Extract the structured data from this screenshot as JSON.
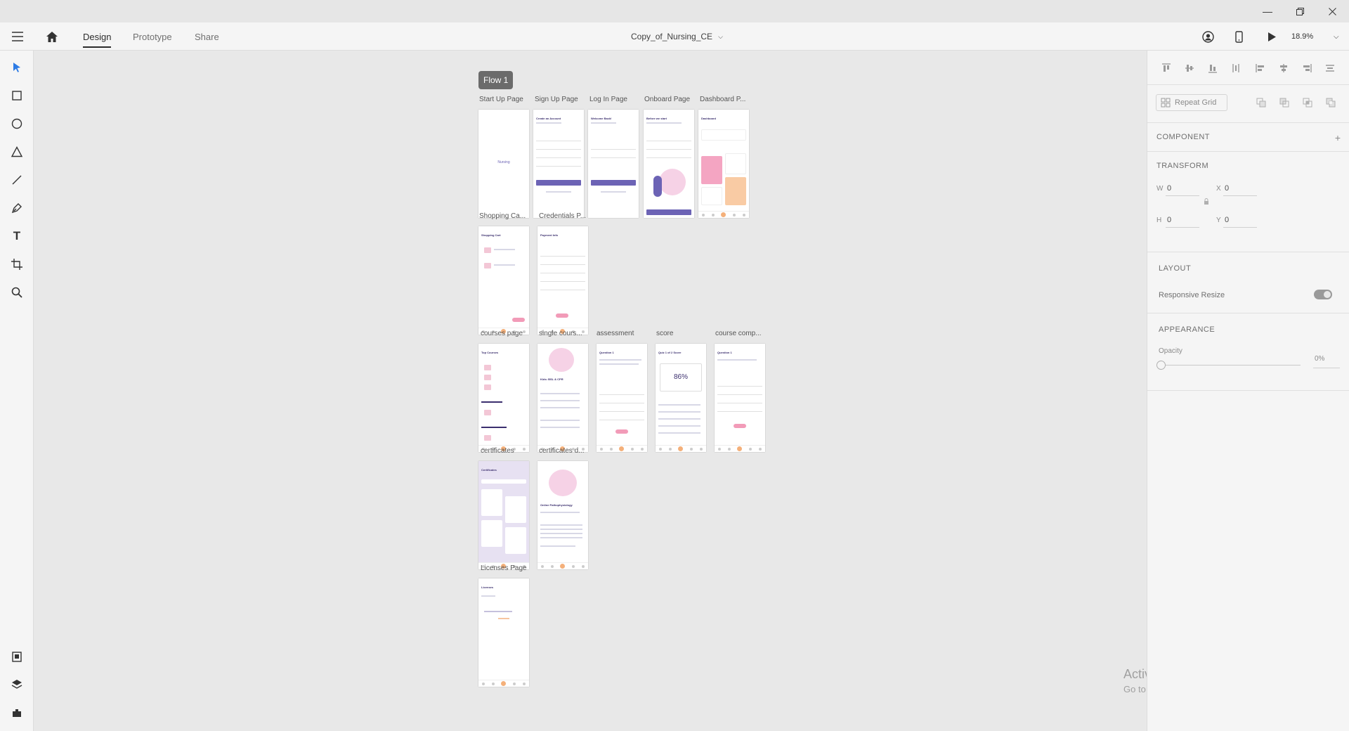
{
  "window": {
    "controls": [
      "minimize",
      "restore",
      "close"
    ]
  },
  "appbar": {
    "tabs": [
      {
        "label": "Design",
        "active": true
      },
      {
        "label": "Prototype",
        "active": false
      },
      {
        "label": "Share",
        "active": false
      }
    ],
    "document_title": "Copy_of_Nursing_CE",
    "zoom": "18.9%"
  },
  "toolbar": {
    "tools": [
      "select-icon",
      "rectangle-icon",
      "ellipse-icon",
      "polygon-icon",
      "line-icon",
      "pen-icon",
      "text-icon",
      "artboard-icon",
      "zoom-icon"
    ],
    "bottom_tools": [
      "document-assets-icon",
      "layers-icon",
      "plugins-icon"
    ]
  },
  "canvas": {
    "flow_label": "Flow 1",
    "artboards": [
      {
        "label": "Start Up Page",
        "title": "Nursing"
      },
      {
        "label": "Sign Up Page",
        "title": "Create an Account"
      },
      {
        "label": "Log In Page",
        "title": "Welcome Back!"
      },
      {
        "label": "Onboard Page",
        "title": "Before we start"
      },
      {
        "label": "Dashboard P...",
        "title": "Dashboard"
      },
      {
        "label": "Shopping Ca...",
        "title": "Shopping Cart"
      },
      {
        "label": "Credentials P...",
        "title": "Payment Info"
      },
      {
        "label": "courses page",
        "title": "Top Courses"
      },
      {
        "label": "single cours...",
        "title": "Kids: BSL & CPR"
      },
      {
        "label": "assessment",
        "title": "Question 1"
      },
      {
        "label": "score",
        "title": "Quiz 1 of 2 Score",
        "score": "86%"
      },
      {
        "label": "course comp...",
        "title": "Question 1"
      },
      {
        "label": "certificates",
        "title": "Certificates"
      },
      {
        "label": "certificates d...",
        "title": "Online Pathophysiology"
      },
      {
        "label": "Licenses Page",
        "title": "Licenses"
      }
    ],
    "watermark_title": "Activate Windows",
    "watermark_sub": "Go to Settings to activate Windows."
  },
  "panel": {
    "repeat_grid": "Repeat Grid",
    "component": "COMPONENT",
    "transform": "TRANSFORM",
    "w_label": "W",
    "w_value": "0",
    "x_label": "X",
    "x_value": "0",
    "h_label": "H",
    "h_value": "0",
    "y_label": "Y",
    "y_value": "0",
    "layout": "LAYOUT",
    "responsive_resize": "Responsive Resize",
    "appearance": "APPEARANCE",
    "opacity_label": "Opacity",
    "opacity_value": "0%"
  }
}
